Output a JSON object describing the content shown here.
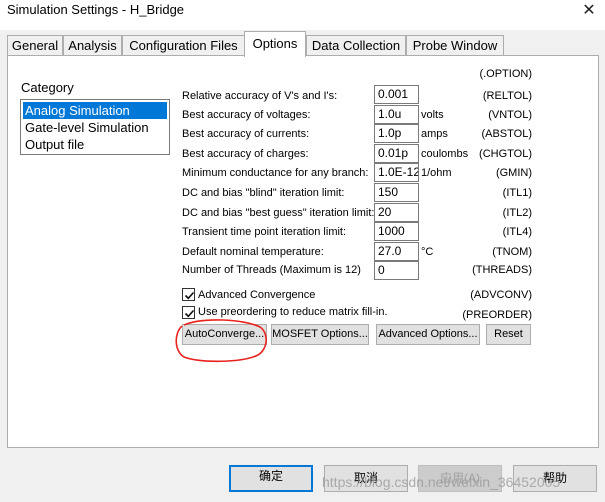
{
  "window": {
    "title": "Simulation Settings - H_Bridge",
    "close_glyph": "✕"
  },
  "tabs": [
    {
      "label": "General"
    },
    {
      "label": "Analysis"
    },
    {
      "label": "Configuration Files"
    },
    {
      "label": "Options",
      "active": true
    },
    {
      "label": "Data Collection"
    },
    {
      "label": "Probe Window"
    }
  ],
  "category": {
    "label": "Category",
    "items": [
      {
        "label": "Analog Simulation",
        "selected": true
      },
      {
        "label": "Gate-level Simulation"
      },
      {
        "label": "Output file"
      }
    ]
  },
  "options_header": "(.OPTION)",
  "params": [
    {
      "label": "Relative accuracy of V's and I's:",
      "value": "0.001",
      "unit": "",
      "code": "(RELTOL)"
    },
    {
      "label": "Best accuracy of voltages:",
      "value": "1.0u",
      "unit": "volts",
      "code": "(VNTOL)"
    },
    {
      "label": "Best accuracy of currents:",
      "value": "1.0p",
      "unit": "amps",
      "code": "(ABSTOL)"
    },
    {
      "label": "Best accuracy of charges:",
      "value": "0.01p",
      "unit": "coulombs",
      "code": "(CHGTOL)"
    },
    {
      "label": "Minimum conductance for any branch:",
      "value": "1.0E-12",
      "unit": "1/ohm",
      "code": "(GMIN)"
    },
    {
      "label": "DC and bias \"blind\" iteration limit:",
      "value": "150",
      "unit": "",
      "code": "(ITL1)"
    },
    {
      "label": "DC and bias \"best guess\" iteration limit:",
      "value": "20",
      "unit": "",
      "code": "(ITL2)"
    },
    {
      "label": "Transient time point iteration limit:",
      "value": "1000",
      "unit": "",
      "code": "(ITL4)"
    },
    {
      "label": "Default nominal temperature:",
      "value": "27.0",
      "unit": "°C",
      "code": "(TNOM)"
    },
    {
      "label": "Number of Threads (Maximum is 12)",
      "value": "0",
      "unit": "",
      "code": "(THREADS)"
    }
  ],
  "checks": [
    {
      "label": "Advanced Convergence",
      "code": "(ADVCONV)",
      "checked": true
    },
    {
      "label": "Use preordering to reduce matrix fill-in.",
      "code": "(PREORDER)",
      "checked": true
    }
  ],
  "buttons": {
    "autoconverge": "AutoConverge...",
    "mosfet": "MOSFET Options...",
    "advanced": "Advanced Options...",
    "reset": "Reset",
    "ok": "确定",
    "cancel": "取消",
    "apply": "应用(A)",
    "help": "帮助"
  },
  "watermark": "https://blog.csdn.net/weixin_36452005",
  "colors": {
    "selection": "#0078d7",
    "default_button_border": "#0078d7",
    "annotation": "#e8231e"
  }
}
